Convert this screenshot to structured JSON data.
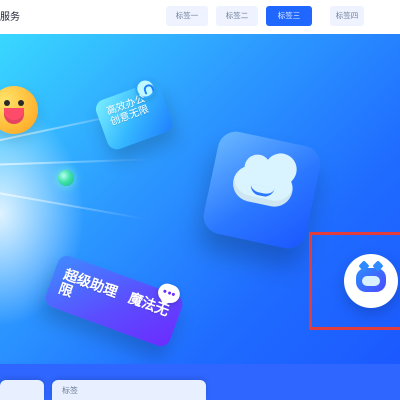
{
  "header": {
    "brand_label": "服务",
    "nav": [
      {
        "label": "标签一"
      },
      {
        "label": "标签二"
      },
      {
        "label": "标签三"
      },
      {
        "label": "标签四"
      }
    ]
  },
  "hero": {
    "efficiency_card": {
      "line1": "高效办公",
      "line2": "创意无限"
    },
    "assistant_card": {
      "line1": "超级助理",
      "line2": "魔法无限"
    }
  },
  "bottom_cards": [
    {
      "label": ""
    },
    {
      "label": "标签"
    }
  ],
  "icons": {
    "emoji": "smiley-face-icon",
    "green_dot": "green-dot-icon",
    "bulb": "lightbulb-icon",
    "cloud": "cloud-icon",
    "chat": "chat-bubble-icon",
    "robot": "robot-icon"
  },
  "colors": {
    "primary_blue": "#1f67ff",
    "hero_light_blue": "#39d8ff",
    "highlight_red": "#e23c3c",
    "white": "#ffffff"
  }
}
